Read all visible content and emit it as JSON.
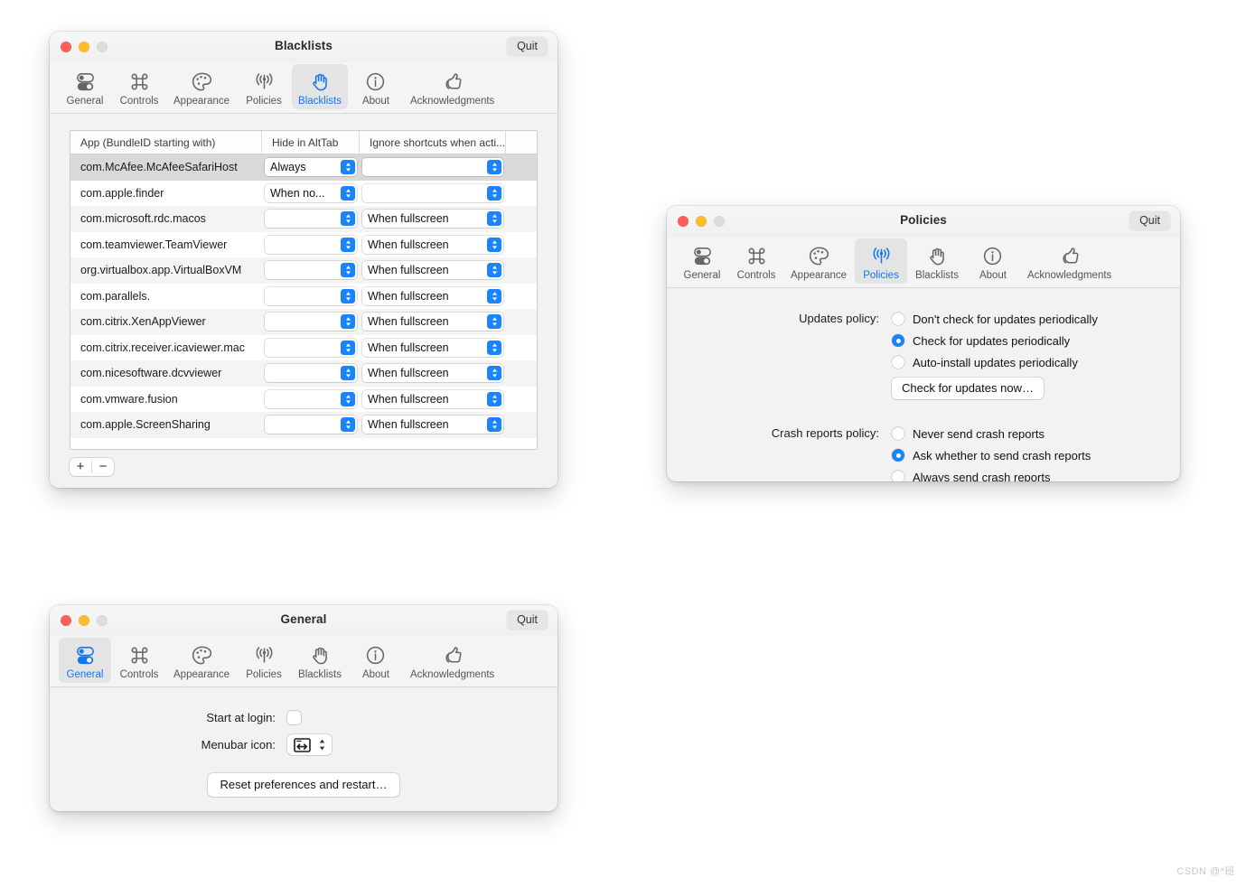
{
  "toolbar_tabs": [
    {
      "id": "general",
      "label": "General",
      "icon": "toggles-icon"
    },
    {
      "id": "controls",
      "label": "Controls",
      "icon": "command-key-icon"
    },
    {
      "id": "appearance",
      "label": "Appearance",
      "icon": "paint-palette-icon"
    },
    {
      "id": "policies",
      "label": "Policies",
      "icon": "broadcast-antenna-icon"
    },
    {
      "id": "blacklists",
      "label": "Blacklists",
      "icon": "raised-hand-icon"
    },
    {
      "id": "about",
      "label": "About",
      "icon": "info-circle-icon"
    },
    {
      "id": "acknowledgments",
      "label": "Acknowledgments",
      "icon": "thumbs-up-icon"
    }
  ],
  "colors": {
    "accent": "#1a84ff",
    "selected_tab_text": "#1476ef",
    "traffic_close": "#ff5f57",
    "traffic_minimize": "#febc2e",
    "traffic_zoom": "#dddddd",
    "row_selected": "#d9d9d9"
  },
  "blacklists_window": {
    "title": "Blacklists",
    "quit_label": "Quit",
    "active_tab": "blacklists",
    "table": {
      "columns": [
        "App (BundleID starting with)",
        "Hide in AltTab",
        "Ignore shortcuts when acti...",
        ""
      ],
      "rows": [
        {
          "app": "com.McAfee.McAfeeSafariHost",
          "hide": "Always",
          "ignore": "",
          "selected": true
        },
        {
          "app": "com.apple.finder",
          "hide": "When no...",
          "ignore": "",
          "selected": false
        },
        {
          "app": "com.microsoft.rdc.macos",
          "hide": "",
          "ignore": "When fullscreen",
          "selected": false
        },
        {
          "app": "com.teamviewer.TeamViewer",
          "hide": "",
          "ignore": "When fullscreen",
          "selected": false
        },
        {
          "app": "org.virtualbox.app.VirtualBoxVM",
          "hide": "",
          "ignore": "When fullscreen",
          "selected": false
        },
        {
          "app": "com.parallels.",
          "hide": "",
          "ignore": "When fullscreen",
          "selected": false
        },
        {
          "app": "com.citrix.XenAppViewer",
          "hide": "",
          "ignore": "When fullscreen",
          "selected": false
        },
        {
          "app": "com.citrix.receiver.icaviewer.mac",
          "hide": "",
          "ignore": "When fullscreen",
          "selected": false
        },
        {
          "app": "com.nicesoftware.dcvviewer",
          "hide": "",
          "ignore": "When fullscreen",
          "selected": false
        },
        {
          "app": "com.vmware.fusion",
          "hide": "",
          "ignore": "When fullscreen",
          "selected": false
        },
        {
          "app": "com.apple.ScreenSharing",
          "hide": "",
          "ignore": "When fullscreen",
          "selected": false
        }
      ]
    },
    "add_label": "+",
    "remove_label": "−"
  },
  "policies_window": {
    "title": "Policies",
    "quit_label": "Quit",
    "active_tab": "policies",
    "updates": {
      "label": "Updates policy:",
      "options": [
        {
          "label": "Don't check for updates periodically",
          "selected": false
        },
        {
          "label": "Check for updates periodically",
          "selected": true
        },
        {
          "label": "Auto-install updates periodically",
          "selected": false
        }
      ],
      "button_label": "Check for updates now…"
    },
    "crash": {
      "label": "Crash reports policy:",
      "options": [
        {
          "label": "Never send crash reports",
          "selected": false
        },
        {
          "label": "Ask whether to send crash reports",
          "selected": true
        },
        {
          "label": "Always send crash reports",
          "selected": false
        }
      ]
    }
  },
  "general_window": {
    "title": "General",
    "quit_label": "Quit",
    "active_tab": "general",
    "start_at_login": {
      "label": "Start at login:",
      "checked": false
    },
    "menubar_icon": {
      "label": "Menubar icon:",
      "value_icon": "alttab-window-arrows-icon"
    },
    "reset_button_label": "Reset preferences and restart…"
  },
  "watermark": "CSDN @*班"
}
